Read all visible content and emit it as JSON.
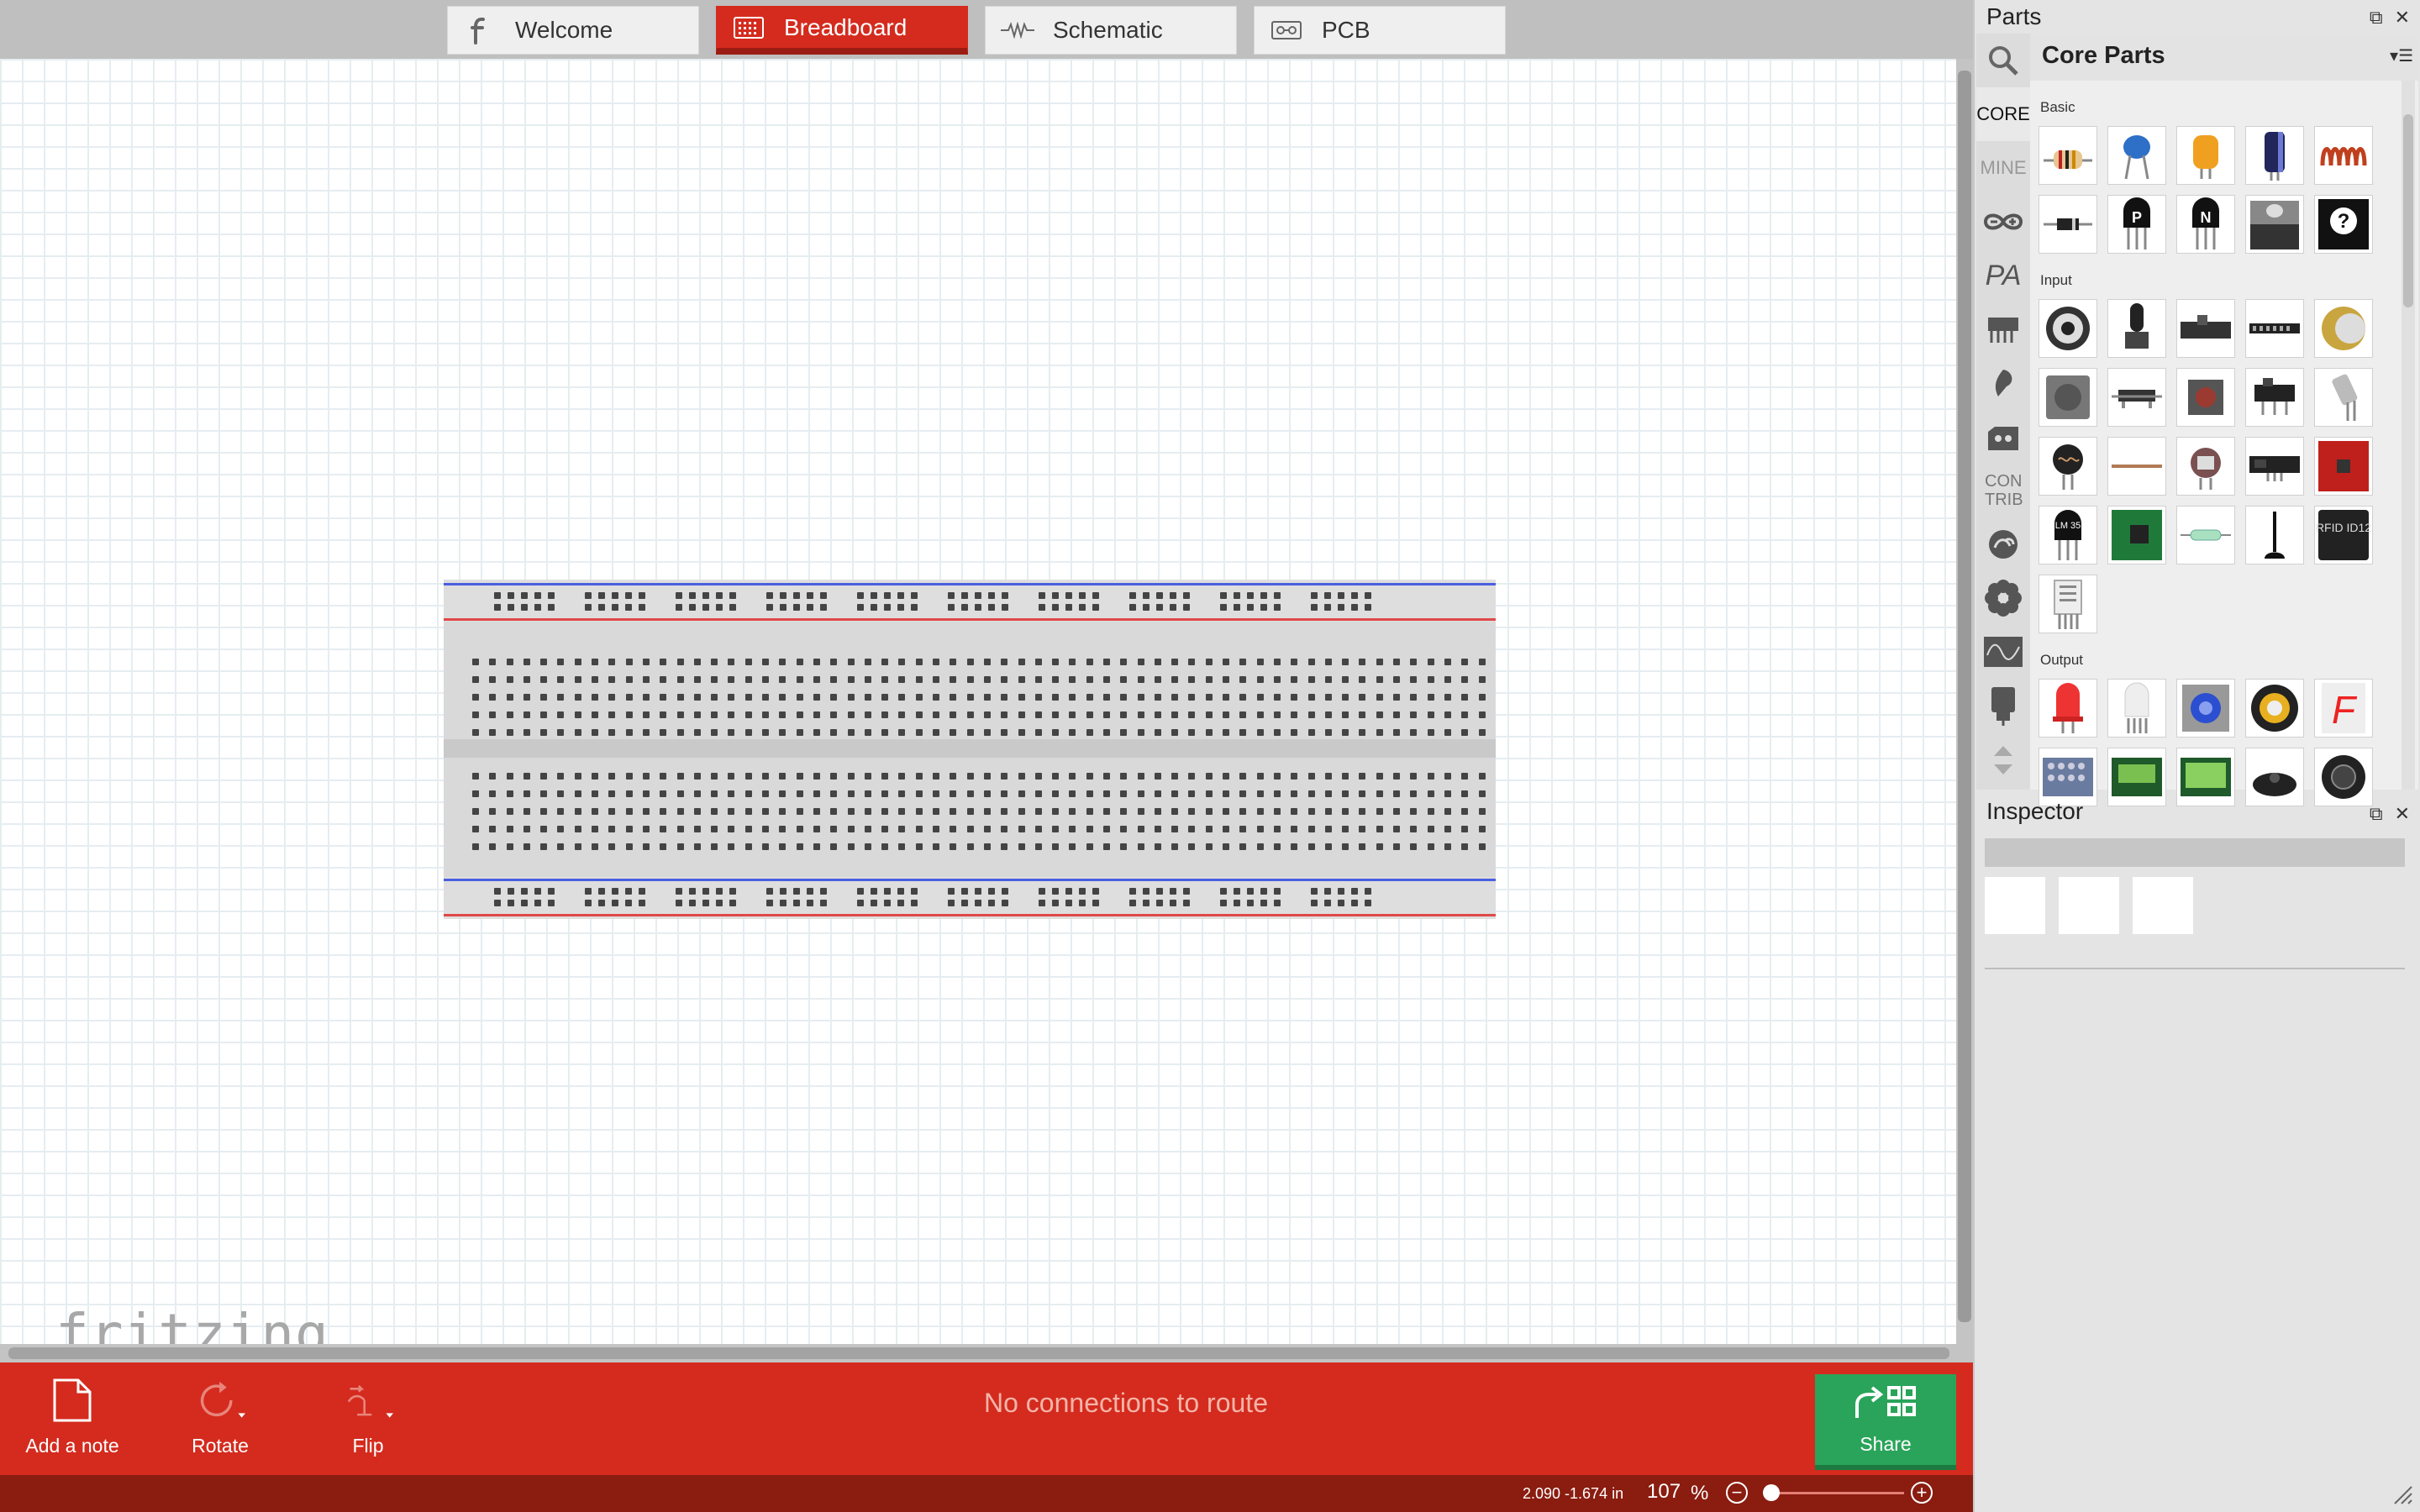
{
  "tabs": [
    {
      "label": "Welcome",
      "icon": "fritzing-f-icon"
    },
    {
      "label": "Breadboard",
      "icon": "breadboard-icon",
      "active": true
    },
    {
      "label": "Schematic",
      "icon": "resistor-wave-icon"
    },
    {
      "label": "PCB",
      "icon": "pcb-icon"
    }
  ],
  "logo": "fritzing",
  "toolbar": {
    "add_note": "Add a note",
    "rotate": "Rotate",
    "flip": "Flip",
    "route_status": "No connections to route",
    "share": "Share"
  },
  "statusbar": {
    "coords": "2.090 -1.674 in",
    "zoom": "107",
    "zoom_unit": "%"
  },
  "parts": {
    "title": "Parts",
    "bin_name": "Core Parts",
    "bin_tabs": [
      "CORE",
      "MINE",
      "arduino-icon",
      "PA",
      "intel-icon",
      "snootlab-icon",
      "seeed-icon",
      "CON TRIB",
      "loopy-icon",
      "flower-icon",
      "oscilloscope-icon",
      "connector-icon"
    ],
    "sections": {
      "basic": "Basic",
      "input": "Input",
      "output": "Output"
    },
    "chip_labels": {
      "lm": "LM 35",
      "rfid": "RFID ID12",
      "seven_seg": "F"
    }
  },
  "inspector": {
    "title": "Inspector"
  },
  "colors": {
    "accent_red": "#d42b1e",
    "dark_red": "#8a1c10",
    "share_green": "#2aa45a"
  }
}
